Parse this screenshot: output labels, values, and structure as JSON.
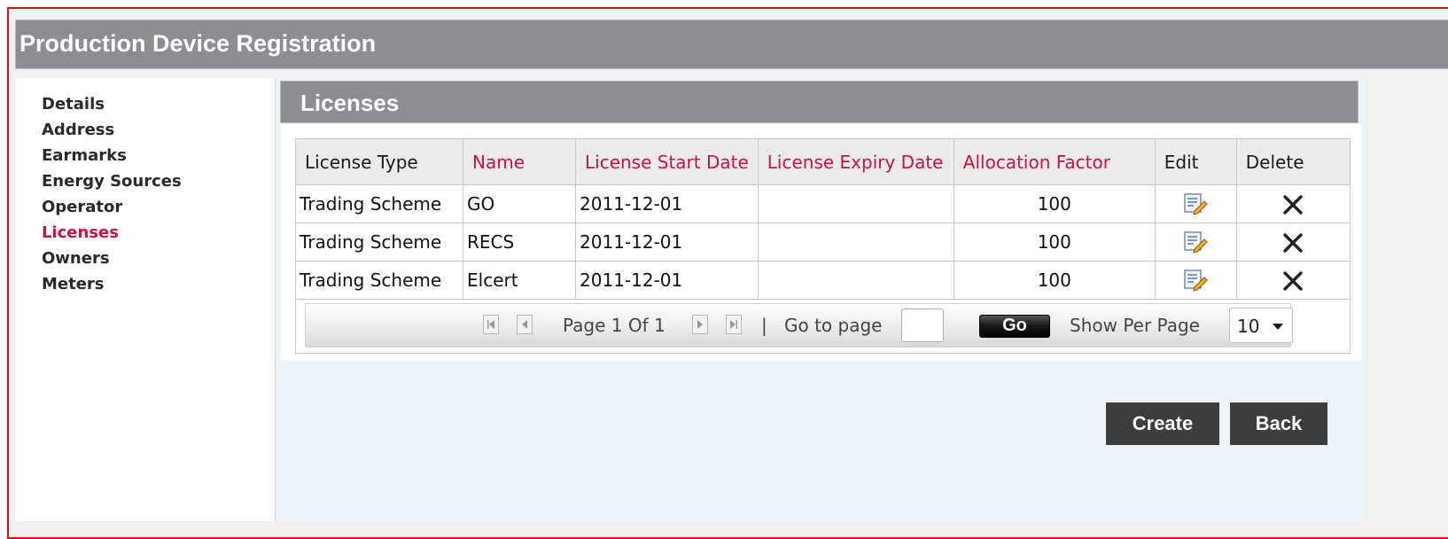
{
  "page": {
    "title": "Production Device Registration"
  },
  "nav": {
    "items": [
      {
        "label": "Details"
      },
      {
        "label": "Address"
      },
      {
        "label": "Earmarks"
      },
      {
        "label": "Energy Sources"
      },
      {
        "label": "Operator"
      },
      {
        "label": "Licenses",
        "active": true
      },
      {
        "label": "Owners"
      },
      {
        "label": "Meters"
      }
    ]
  },
  "section": {
    "title": "Licenses"
  },
  "table": {
    "columns": [
      {
        "label": "License Type",
        "sortable": false
      },
      {
        "label": "Name",
        "sortable": true
      },
      {
        "label": "License Start Date",
        "sortable": true
      },
      {
        "label": "License Expiry Date",
        "sortable": true
      },
      {
        "label": "Allocation Factor",
        "sortable": true
      },
      {
        "label": "Edit",
        "sortable": false
      },
      {
        "label": "Delete",
        "sortable": false
      }
    ],
    "rows": [
      {
        "type": "Trading Scheme",
        "name": "GO",
        "start": "2011-12-01",
        "expiry": "",
        "factor": "100"
      },
      {
        "type": "Trading Scheme",
        "name": "RECS",
        "start": "2011-12-01",
        "expiry": "",
        "factor": "100"
      },
      {
        "type": "Trading Scheme",
        "name": "Elcert",
        "start": "2011-12-01",
        "expiry": "",
        "factor": "100"
      }
    ]
  },
  "pager": {
    "page_text": "Page 1 Of 1",
    "separator": "|",
    "goto_label": "Go to page",
    "goto_value": "",
    "go_label": "Go",
    "per_page_label": "Show Per Page",
    "per_page_value": "10"
  },
  "actions": {
    "create": "Create",
    "back": "Back"
  },
  "colors": {
    "accent": "#c8143f",
    "header_bg": "#8e8d92",
    "frame": "#e01010",
    "button_bg": "#3d3d3d"
  },
  "icons": {
    "edit": "edit-note-icon",
    "delete": "close-x-icon"
  }
}
